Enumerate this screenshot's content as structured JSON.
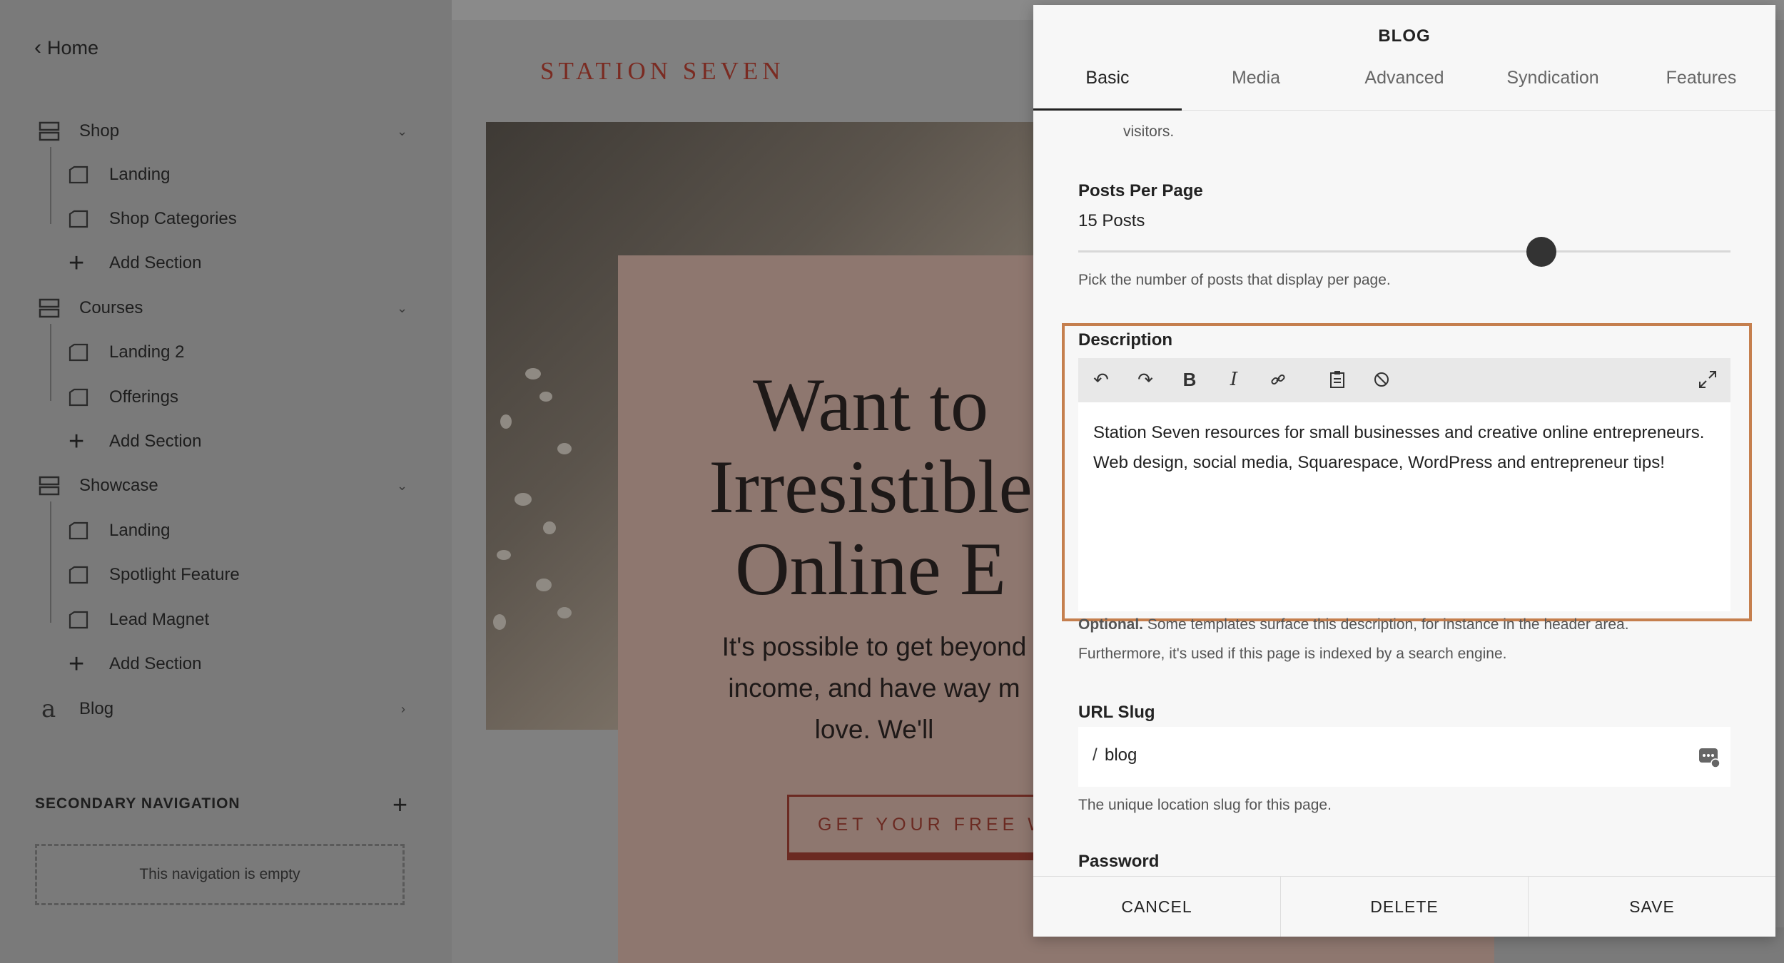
{
  "sidebar": {
    "back_label": "Home",
    "sections": [
      {
        "label": "Shop",
        "children": [
          "Landing",
          "Shop Categories"
        ],
        "add_label": "Add Section"
      },
      {
        "label": "Courses",
        "children": [
          "Landing 2",
          "Offerings"
        ],
        "add_label": "Add Section"
      },
      {
        "label": "Showcase",
        "children": [
          "Landing",
          "Spotlight Feature",
          "Lead Magnet"
        ],
        "add_label": "Add Section"
      }
    ],
    "blog_label": "Blog",
    "blog_icon_glyph": "a",
    "secondary_nav_title": "SECONDARY NAVIGATION",
    "secondary_nav_empty": "This navigation is empty"
  },
  "preview": {
    "brand": "STATION SEVEN",
    "hero_title": [
      "Want to",
      "Irresistible",
      "Online E"
    ],
    "hero_sub": [
      "It's possible to get beyond",
      "income, and have way m",
      "love. We'll"
    ],
    "hero_button": "GET YOUR FREE WE"
  },
  "panel": {
    "title": "BLOG",
    "tabs": [
      "Basic",
      "Media",
      "Advanced",
      "Syndication",
      "Features"
    ],
    "active_tab": "Basic",
    "top_fragment": "visitors.",
    "posts_per_page": {
      "label": "Posts Per Page",
      "value_text": "15 Posts",
      "slider_fraction": 0.71,
      "help": "Pick the number of posts that display per page."
    },
    "description": {
      "label": "Description",
      "text": "Station Seven resources for small businesses and creative online entrepreneurs. Web design, social media, Squarespace, WordPress and entrepreneur tips!",
      "help_lead": "Optional.",
      "help_rest": " Some templates surface this description, for instance in the header area.",
      "help_line2": "Furthermore, it's used if this page is indexed by a search engine."
    },
    "url_slug": {
      "label": "URL Slug",
      "prefix": "/",
      "value": "blog",
      "help": "The unique location slug for this page."
    },
    "password_label": "Password",
    "footer": {
      "cancel": "CANCEL",
      "delete": "DELETE",
      "save": "SAVE"
    }
  },
  "colors": {
    "highlight_border": "#c57f4e",
    "brand": "#7a2b22",
    "panel_bg": "#f7f7f7"
  }
}
